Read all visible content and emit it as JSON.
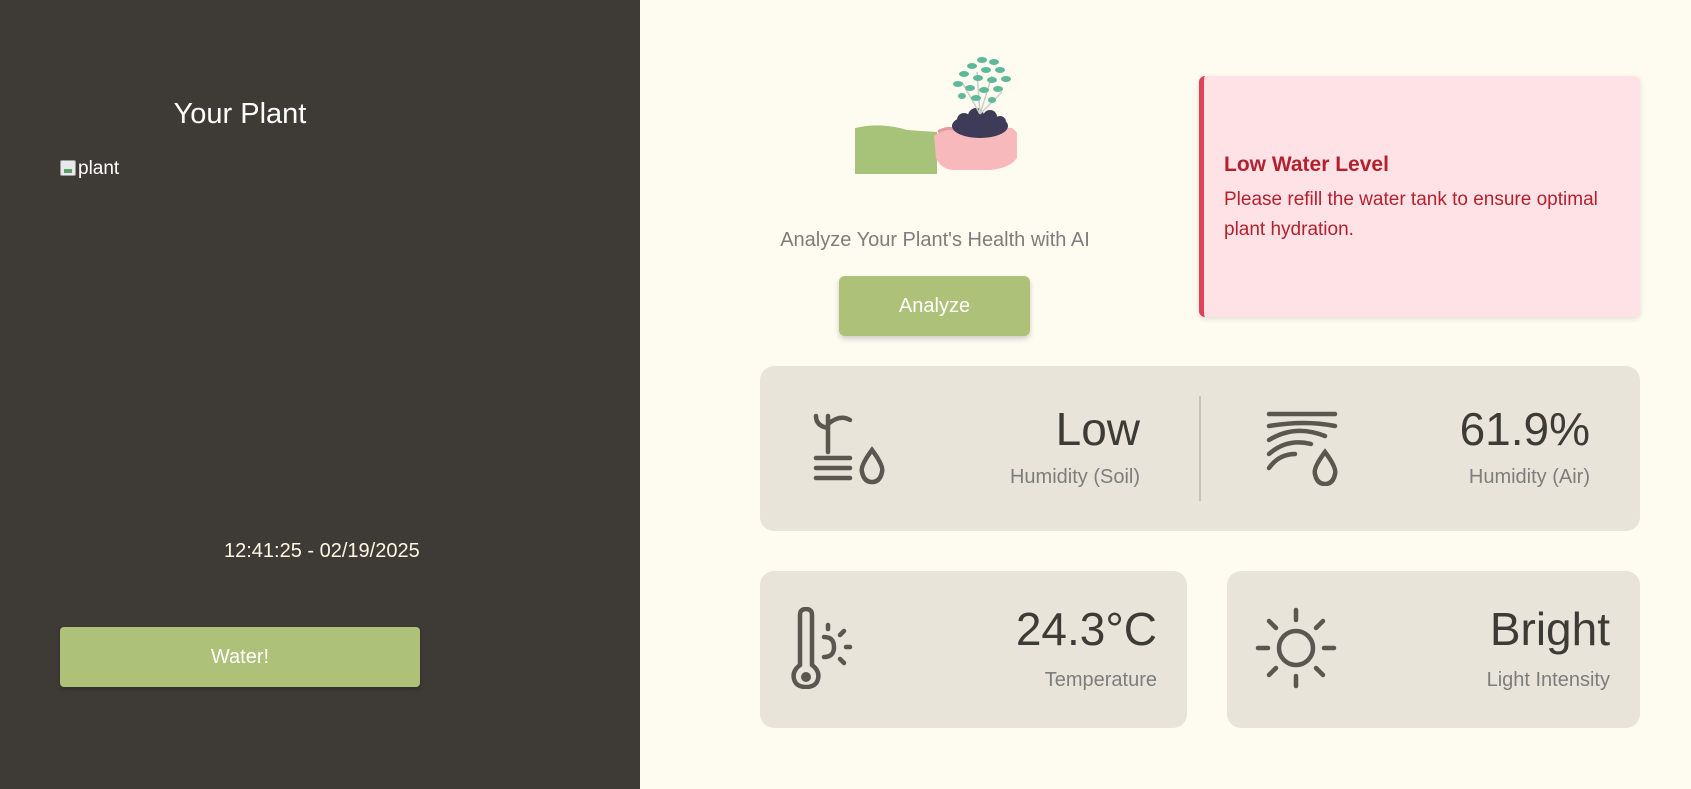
{
  "sidebar": {
    "title": "Your Plant",
    "image_alt": "plant",
    "timestamp": "12:41:25 - 02/19/2025",
    "water_button": "Water!",
    "background": "#3e3b36"
  },
  "analyze": {
    "text": "Analyze Your Plant's Health with AI",
    "button": "Analyze"
  },
  "alert": {
    "title": "Low Water Level",
    "message": "Please refill the water tank to ensure optimal plant hydration.",
    "accent": "#e04058"
  },
  "metrics": {
    "soil_humidity": {
      "value": "Low",
      "label": "Humidity (Soil)",
      "icon": "soil-humidity-icon"
    },
    "air_humidity": {
      "value": "61.9%",
      "label": "Humidity (Air)",
      "icon": "air-humidity-icon"
    },
    "temperature": {
      "value": "24.3°C",
      "label": "Temperature",
      "icon": "thermometer-icon"
    },
    "light": {
      "value": "Bright",
      "label": "Light Intensity",
      "icon": "sun-icon"
    }
  },
  "colors": {
    "accent_green": "#adc178",
    "page_background": "#fefcf0",
    "card_background": "#e8e4d9"
  }
}
